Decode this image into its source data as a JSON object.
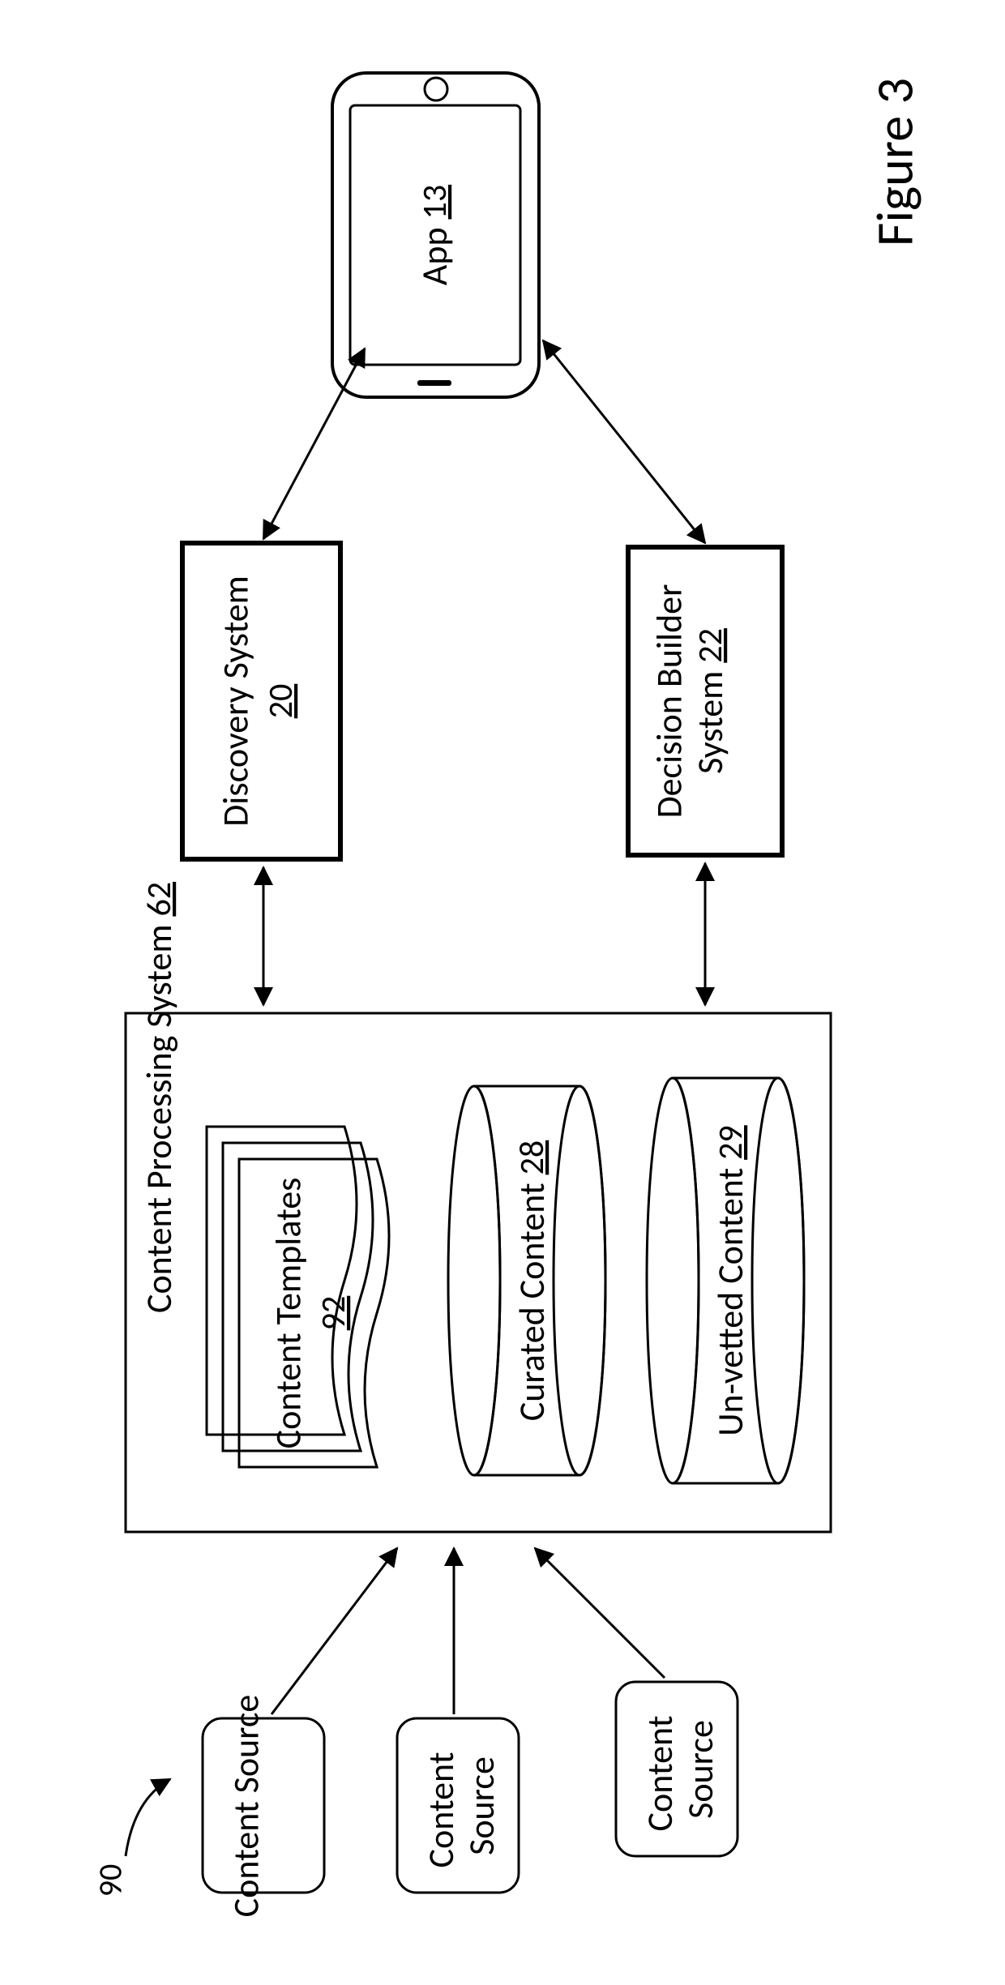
{
  "figure": {
    "caption_number": "90",
    "label": "Figure 3"
  },
  "sources": {
    "s1": "Content Source",
    "s2": "Content Source",
    "s3": "Content Source"
  },
  "cps": {
    "title": "Content Processing System",
    "title_ref": "62",
    "templates": {
      "label": "Content Templates",
      "ref": "92"
    },
    "curated": {
      "label": "Curated Content",
      "ref": "28"
    },
    "unvetted": {
      "label": "Un-vetted Content",
      "ref": "29"
    }
  },
  "discovery": {
    "label": "Discovery System",
    "ref": "20"
  },
  "decision": {
    "line1": "Decision Builder",
    "line2": "System",
    "ref": "22"
  },
  "app": {
    "label": "App",
    "ref": "13"
  }
}
